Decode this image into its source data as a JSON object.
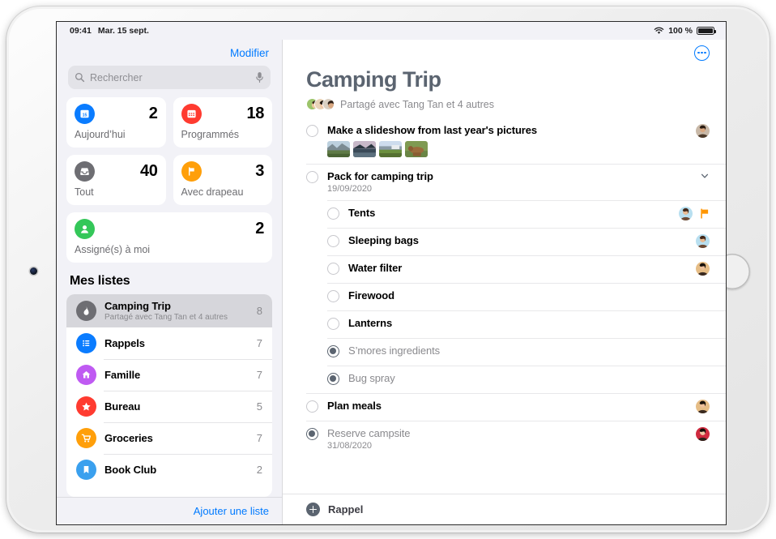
{
  "statusbar": {
    "time": "09:41",
    "date": "Mar. 15 sept.",
    "battery_text": "100 %"
  },
  "sidebar": {
    "edit_label": "Modifier",
    "search": {
      "placeholder": "Rechercher",
      "value": ""
    },
    "smart_cards": [
      {
        "label": "Aujourd’hui",
        "count": "2",
        "icon": "calendar-icon",
        "color": "#0a7cff",
        "day": "15"
      },
      {
        "label": "Programmés",
        "count": "18",
        "icon": "calendar-days-icon",
        "color": "#ff3b30"
      },
      {
        "label": "Tout",
        "count": "40",
        "icon": "tray-icon",
        "color": "#6e6e73"
      },
      {
        "label": "Avec drapeau",
        "count": "3",
        "icon": "flag-icon",
        "color": "#ff9f0a"
      },
      {
        "label": "Assigné(s) à moi",
        "count": "2",
        "icon": "person-icon",
        "color": "#34c759"
      }
    ],
    "lists_title": "Mes listes",
    "lists": [
      {
        "name": "Camping Trip",
        "subtitle": "Partagé avec Tang Tan et 4 autres",
        "count": "8",
        "icon": "flame-icon",
        "color": "#6e6e73",
        "selected": true
      },
      {
        "name": "Rappels",
        "subtitle": "",
        "count": "7",
        "icon": "list-bullet-icon",
        "color": "#0a7cff",
        "selected": false
      },
      {
        "name": "Famille",
        "subtitle": "",
        "count": "7",
        "icon": "house-icon",
        "color": "#bf5af2",
        "selected": false
      },
      {
        "name": "Bureau",
        "subtitle": "",
        "count": "5",
        "icon": "star-icon",
        "color": "#ff3b30",
        "selected": false
      },
      {
        "name": "Groceries",
        "subtitle": "",
        "count": "7",
        "icon": "cart-icon",
        "color": "#ff9f0a",
        "selected": false
      },
      {
        "name": "Book Club",
        "subtitle": "",
        "count": "2",
        "icon": "bookmark-icon",
        "color": "#3aa0ee",
        "selected": false
      }
    ],
    "add_list_label": "Ajouter une liste"
  },
  "content": {
    "title": "Camping Trip",
    "shared_text": "Partagé avec Tang Tan et 4 autres",
    "more_button_label": "",
    "reminders": [
      {
        "title": "Make a slideshow from last year's pictures",
        "date": "",
        "completed": false,
        "sub": false,
        "avatar": "avatar-dark",
        "flagged": false,
        "chevron": false,
        "thumbs": [
          "photo-mountain",
          "photo-lake",
          "photo-field",
          "photo-bear"
        ]
      },
      {
        "title": "Pack for camping trip",
        "date": "19/09/2020",
        "completed": false,
        "sub": false,
        "avatar": "",
        "flagged": false,
        "chevron": true,
        "thumbs": []
      },
      {
        "title": "Tents",
        "date": "",
        "completed": false,
        "sub": true,
        "avatar": "avatar-blue",
        "flagged": true,
        "chevron": false,
        "thumbs": []
      },
      {
        "title": "Sleeping bags",
        "date": "",
        "completed": false,
        "sub": true,
        "avatar": "avatar-blue",
        "flagged": false,
        "chevron": false,
        "thumbs": []
      },
      {
        "title": "Water filter",
        "date": "",
        "completed": false,
        "sub": true,
        "avatar": "avatar-tan",
        "flagged": false,
        "chevron": false,
        "thumbs": []
      },
      {
        "title": "Firewood",
        "date": "",
        "completed": false,
        "sub": true,
        "avatar": "",
        "flagged": false,
        "chevron": false,
        "thumbs": []
      },
      {
        "title": "Lanterns",
        "date": "",
        "completed": false,
        "sub": true,
        "avatar": "",
        "flagged": false,
        "chevron": false,
        "thumbs": []
      },
      {
        "title": "S’mores ingredients",
        "date": "",
        "completed": true,
        "sub": true,
        "avatar": "",
        "flagged": false,
        "chevron": false,
        "thumbs": []
      },
      {
        "title": "Bug spray",
        "date": "",
        "completed": true,
        "sub": true,
        "avatar": "",
        "flagged": false,
        "chevron": false,
        "thumbs": []
      },
      {
        "title": "Plan meals",
        "date": "",
        "completed": false,
        "sub": false,
        "avatar": "avatar-tan",
        "flagged": false,
        "chevron": false,
        "thumbs": []
      },
      {
        "title": "Reserve campsite",
        "date": "31/08/2020",
        "completed": true,
        "sub": false,
        "avatar": "avatar-red",
        "flagged": false,
        "chevron": false,
        "thumbs": []
      }
    ],
    "add_reminder_label": "Rappel"
  },
  "colors": {
    "accent": "#007aff",
    "title_gray": "#5b6470",
    "flag_orange": "#ff9500",
    "sidebar_bg": "#f2f2f7"
  }
}
